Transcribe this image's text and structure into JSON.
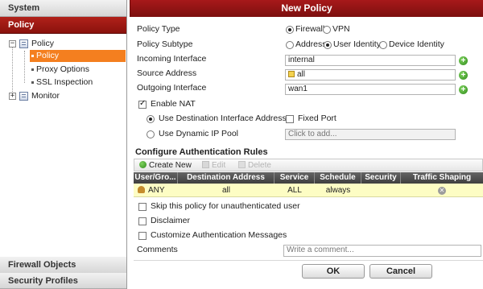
{
  "sidebar": {
    "sections": {
      "system": "System",
      "policy": "Policy",
      "firewall_objects": "Firewall Objects",
      "security_profiles": "Security Profiles"
    },
    "tree": {
      "policy_group": "Policy",
      "policy": "Policy",
      "proxy_options": "Proxy Options",
      "ssl_inspection": "SSL Inspection",
      "monitor": "Monitor"
    }
  },
  "dialog": {
    "title": "New Policy",
    "policy_type": {
      "label": "Policy Type",
      "options": [
        "Firewall",
        "VPN"
      ],
      "selected": "Firewall"
    },
    "policy_subtype": {
      "label": "Policy Subtype",
      "options": [
        "Address",
        "User Identity",
        "Device Identity"
      ],
      "selected": "User Identity"
    },
    "incoming_interface": {
      "label": "Incoming Interface",
      "value": "internal"
    },
    "source_address": {
      "label": "Source Address",
      "value": "all"
    },
    "outgoing_interface": {
      "label": "Outgoing Interface",
      "value": "wan1"
    },
    "enable_nat": {
      "label": "Enable NAT",
      "checked": true
    },
    "nat_dest_iface": {
      "label": "Use Destination Interface Address",
      "selected": true
    },
    "fixed_port": {
      "label": "Fixed Port",
      "checked": false
    },
    "dynamic_ip_pool": {
      "label": "Use Dynamic IP Pool",
      "selected": false,
      "placeholder": "Click to add..."
    },
    "auth_rules": {
      "title": "Configure Authentication Rules",
      "toolbar": {
        "create_new": "Create New",
        "edit": "Edit",
        "delete": "Delete"
      },
      "columns": [
        "User/Gro...",
        "Destination Address",
        "Service",
        "Schedule",
        "Security",
        "Traffic Shaping"
      ],
      "rows": [
        {
          "user": "ANY",
          "destination": "all",
          "service": "ALL",
          "schedule": "always",
          "security": "",
          "traffic_shaping": "disabled"
        }
      ]
    },
    "skip_policy": {
      "label": "Skip this policy for unauthenticated user",
      "checked": false
    },
    "disclaimer": {
      "label": "Disclaimer",
      "checked": false
    },
    "customize_auth": {
      "label": "Customize Authentication Messages",
      "checked": false
    },
    "comments": {
      "label": "Comments",
      "placeholder": "Write a comment..."
    },
    "ok": "OK",
    "cancel": "Cancel"
  },
  "colors": {
    "header_red": "#a7191a",
    "selection_orange": "#f47f1f",
    "row_highlight": "#fdfdc4",
    "add_green": "#2f8a1a"
  }
}
